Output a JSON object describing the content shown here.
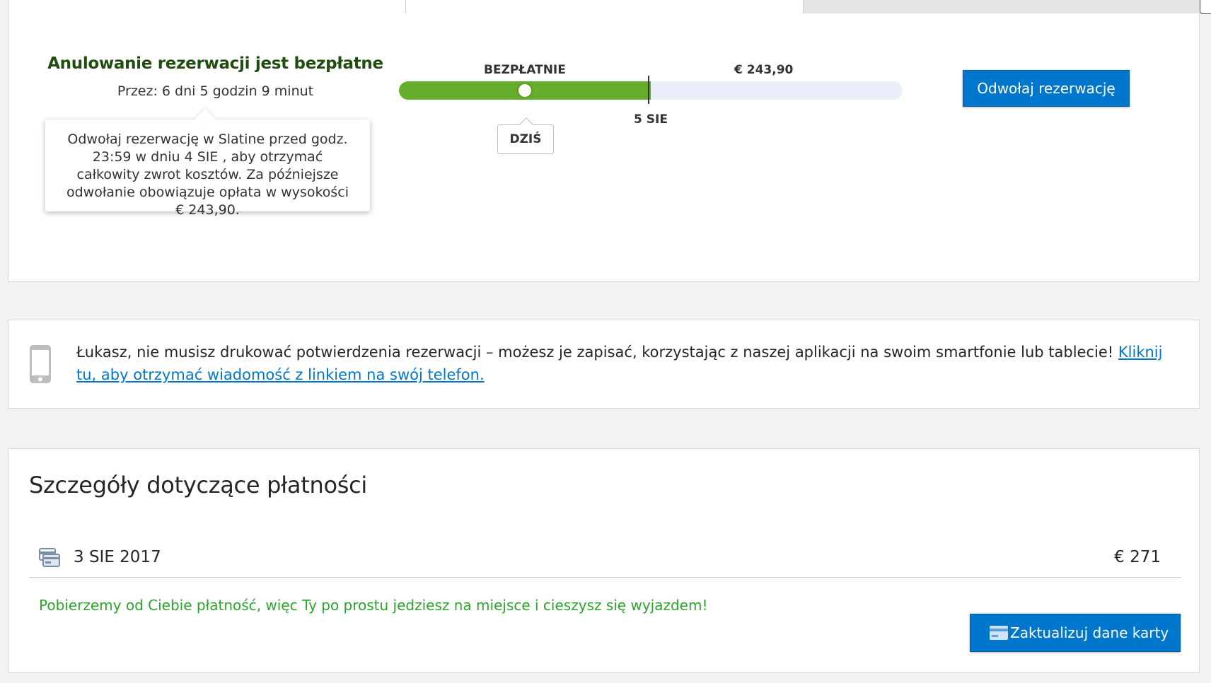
{
  "cancellation": {
    "title": "Anulowanie rezerwacji jest bezpłatne",
    "time_left": "Przez: 6 dni 5 godzin 9 minut",
    "tooltip_text": "Odwołaj rezerwację w Slatine przed godz. 23:59 w dniu 4 SIE , aby otrzymać całkowity zwrot kosztów. Za późniejsze odwołanie obowiązuje opłata w wysokości € 243,90.",
    "button_label": "Odwołaj rezerwację"
  },
  "timeline": {
    "free_label": "BEZPŁATNIE",
    "fee_label": "€ 243,90",
    "deadline_label": "5 SIE",
    "today_label": "DZIŚ",
    "free_fraction": 0.5,
    "today_fraction": 0.25,
    "colors": {
      "free": "#66ad2b",
      "fee": "#e9f0f8"
    }
  },
  "app_promo": {
    "icon": "smartphone-icon",
    "text": "Łukasz, nie musisz drukować potwierdzenia rezerwacji – możesz je zapisać, korzystając z naszej aplikacji na swoim smartfonie lub tablecie! ",
    "link_text": "Kliknij tu, aby otrzymać wiadomość z linkiem na swój telefon."
  },
  "payment": {
    "title": "Szczegóły dotyczące płatności",
    "icon": "credit-card-icon",
    "date": "3 SIE 2017",
    "amount": "€ 271",
    "note": "Pobierzemy od Ciebie płatność, więc Ty po prostu jedziesz na miejsce i cieszysz się wyjazdem!",
    "update_button_label": "Zaktualizuj dane karty"
  },
  "colors": {
    "accent": "#0077cc",
    "success_text": "#2ba52b",
    "title_green": "#1f4d0f"
  }
}
